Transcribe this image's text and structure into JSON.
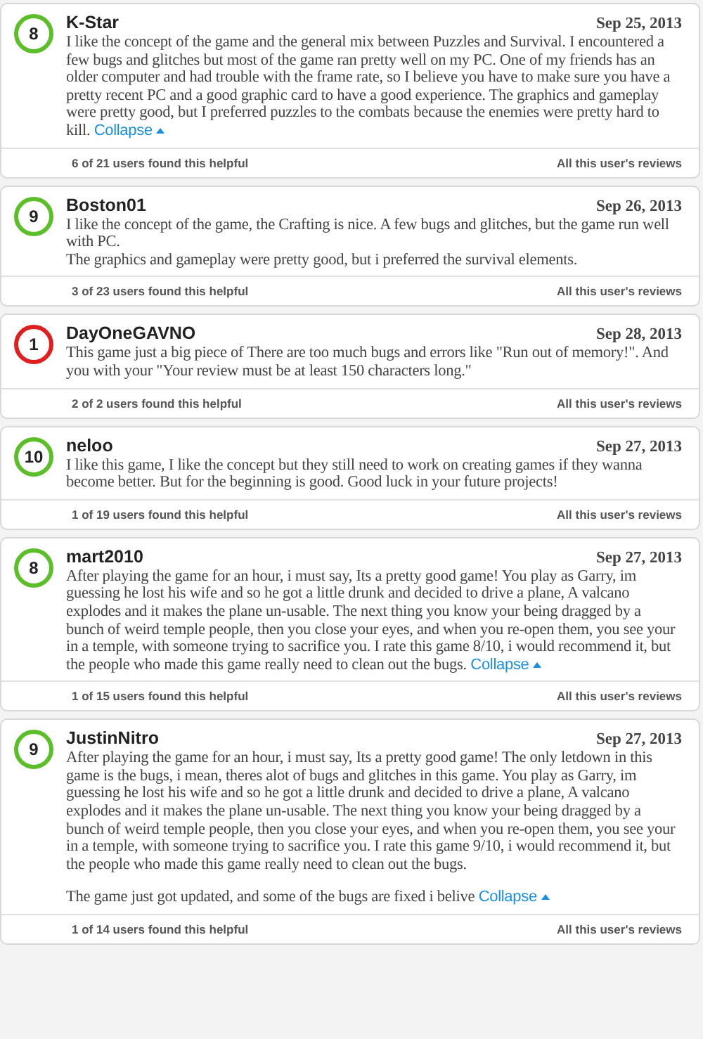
{
  "reviews": [
    {
      "score": "8",
      "color": "#5cbf2a",
      "name": "K-Star",
      "date": "Sep 25, 2013",
      "paragraphs": [
        "I like the concept of the game and the general mix between Puzzles and Survival. I encountered a few bugs and glitches but most of the game ran pretty well on my PC. One of my friends has an older computer and had trouble with the frame rate, so I believe you have to make sure you have a pretty recent PC and a good graphic card to have a good experience. The graphics and gameplay were pretty good, but I preferred puzzles to the combats because the enemies were pretty hard to kill."
      ],
      "collapse": "Collapse",
      "helpful": "6 of 21 users found this helpful",
      "all_reviews": "All this user's reviews"
    },
    {
      "score": "9",
      "color": "#5cbf2a",
      "name": "Boston01",
      "date": "Sep 26, 2013",
      "paragraphs": [
        "I like the concept of the game, the Crafting is nice. A few bugs and glitches, but the game run well with PC.\nThe graphics and gameplay were pretty good, but i preferred the survival elements."
      ],
      "helpful": "3 of 23 users found this helpful",
      "all_reviews": "All this user's reviews"
    },
    {
      "score": "1",
      "color": "#e02020",
      "name": "DayOneGAVNO",
      "date": "Sep 28, 2013",
      "paragraphs": [
        "This game just a big piece of There are too much bugs and errors like \"Run out of memory!\". And you with your \"Your review must be at least 150 characters long.\""
      ],
      "helpful": "2 of 2 users found this helpful",
      "all_reviews": "All this user's reviews"
    },
    {
      "score": "10",
      "color": "#5cbf2a",
      "name": "neloo",
      "date": "Sep 27, 2013",
      "paragraphs": [
        "I like this game, I like the concept but they still need to work on creating games if they wanna become better. But for the beginning is good. Good luck in your future projects!"
      ],
      "helpful": "1 of 19 users found this helpful",
      "all_reviews": "All this user's reviews"
    },
    {
      "score": "8",
      "color": "#5cbf2a",
      "name": "mart2010",
      "date": "Sep 27, 2013",
      "paragraphs": [
        "After playing the game for an hour, i must say, Its a pretty good game! You play as Garry, im guessing he lost his wife and so he got a little drunk and decided to drive a plane, A valcano explodes and it makes the plane un-usable. The next thing you know your being dragged by a bunch of weird temple people, then you close your eyes, and when you re-open them, you see your in a temple, with someone trying to sacrifice you. I rate this game 8/10, i would recommend it, but the people who made this game really need to clean out the bugs."
      ],
      "collapse": "Collapse",
      "helpful": "1 of 15 users found this helpful",
      "all_reviews": "All this user's reviews"
    },
    {
      "score": "9",
      "color": "#5cbf2a",
      "name": "JustinNitro",
      "date": "Sep 27, 2013",
      "paragraphs": [
        "After playing the game for an hour, i must say, Its a pretty good game! The only letdown in this game is the bugs, i mean, theres alot of bugs and glitches in this game. You play as Garry, im guessing he lost his wife and so he got a little drunk and decided to drive a plane, A valcano explodes and it makes the plane un-usable. The next thing you know your being dragged by a bunch of weird temple people, then you close your eyes, and when you re-open them, you see your in a temple, with someone trying to sacrifice you. I rate this game 9/10, i would recommend it, but the people who made this game really need to clean out the bugs.",
        "The game just got updated, and some of the bugs are fixed i belive"
      ],
      "collapse": "Collapse",
      "helpful": "1 of 14 users found this helpful",
      "all_reviews": "All this user's reviews"
    }
  ]
}
